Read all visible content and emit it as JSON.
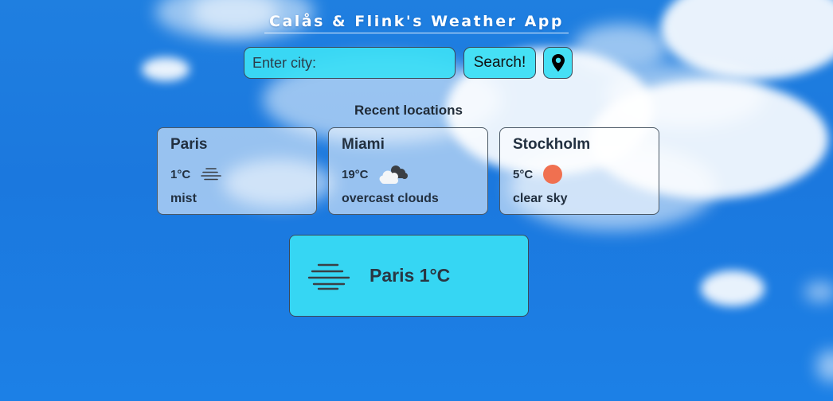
{
  "app": {
    "title": "Calås & Flink's Weather App"
  },
  "search": {
    "placeholder": "Enter city:",
    "value": "",
    "button_label": "Search!",
    "location_icon": "map-pin-icon"
  },
  "recent": {
    "heading": "Recent locations",
    "items": [
      {
        "city": "Paris",
        "temp": "1°C",
        "description": "mist",
        "icon": "mist-icon"
      },
      {
        "city": "Miami",
        "temp": "19°C",
        "description": "overcast clouds",
        "icon": "overcast-clouds-icon"
      },
      {
        "city": "Stockholm",
        "temp": "5°C",
        "description": "clear sky",
        "icon": "sun-icon"
      }
    ]
  },
  "current": {
    "label": "Paris 1°C",
    "icon": "mist-icon"
  },
  "colors": {
    "sky": "#1f7fe0",
    "accent": "#36d6f3",
    "sun": "#f07050",
    "text": "#223040"
  }
}
